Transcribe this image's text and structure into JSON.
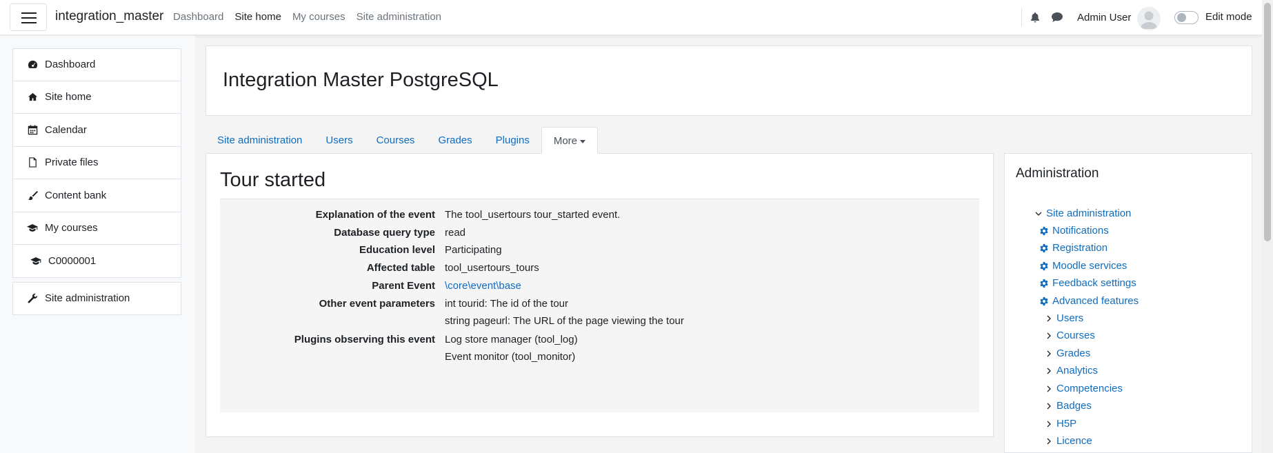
{
  "navbar": {
    "brand": "integration_master",
    "links": [
      {
        "label": "Dashboard",
        "active": false
      },
      {
        "label": "Site home",
        "active": true
      },
      {
        "label": "My courses",
        "active": false
      },
      {
        "label": "Site administration",
        "active": false
      }
    ],
    "user_name": "Admin User",
    "edit_mode_label": "Edit mode"
  },
  "left_nav": {
    "items": [
      {
        "label": "Dashboard",
        "icon": "dashboard-icon"
      },
      {
        "label": "Site home",
        "icon": "home-icon"
      },
      {
        "label": "Calendar",
        "icon": "calendar-icon"
      },
      {
        "label": "Private files",
        "icon": "file-icon"
      },
      {
        "label": "Content bank",
        "icon": "paintbrush-icon"
      },
      {
        "label": "My courses",
        "icon": "graduation-cap-icon"
      },
      {
        "label": "C0000001",
        "icon": "graduation-cap-icon"
      }
    ],
    "admin_item": {
      "label": "Site administration",
      "icon": "wrench-icon"
    }
  },
  "page_header": {
    "title": "Integration Master PostgreSQL"
  },
  "tabs": [
    {
      "label": "Site administration"
    },
    {
      "label": "Users"
    },
    {
      "label": "Courses"
    },
    {
      "label": "Grades"
    },
    {
      "label": "Plugins"
    },
    {
      "label": "More",
      "active": true
    }
  ],
  "main": {
    "title": "Tour started",
    "rows": [
      {
        "key": "Explanation of the event",
        "value": "The tool_usertours tour_started event."
      },
      {
        "key": "Database query type",
        "value": "read"
      },
      {
        "key": "Education level",
        "value": "Participating"
      },
      {
        "key": "Affected table",
        "value": "tool_usertours_tours"
      },
      {
        "key": "Parent Event",
        "value": "\\core\\event\\base",
        "link": true
      },
      {
        "key": "Other event parameters",
        "value": "int tourid: The id of the tour"
      },
      {
        "key": "",
        "value": "string pageurl: The URL of the page viewing the tour"
      },
      {
        "key": "Plugins observing this event",
        "value": "Log store manager (tool_log)"
      },
      {
        "key": "",
        "value": "Event monitor (tool_monitor)"
      }
    ]
  },
  "admin_block": {
    "title": "Administration",
    "root": "Site administration",
    "gear_items": [
      "Notifications",
      "Registration",
      "Moodle services",
      "Feedback settings",
      "Advanced features"
    ],
    "collapsed_items": [
      "Users",
      "Courses",
      "Grades",
      "Analytics",
      "Competencies",
      "Badges",
      "H5P",
      "Licence"
    ]
  },
  "colors": {
    "link": "#0f6cbf",
    "text": "#1d2125",
    "muted": "#6a737b"
  }
}
